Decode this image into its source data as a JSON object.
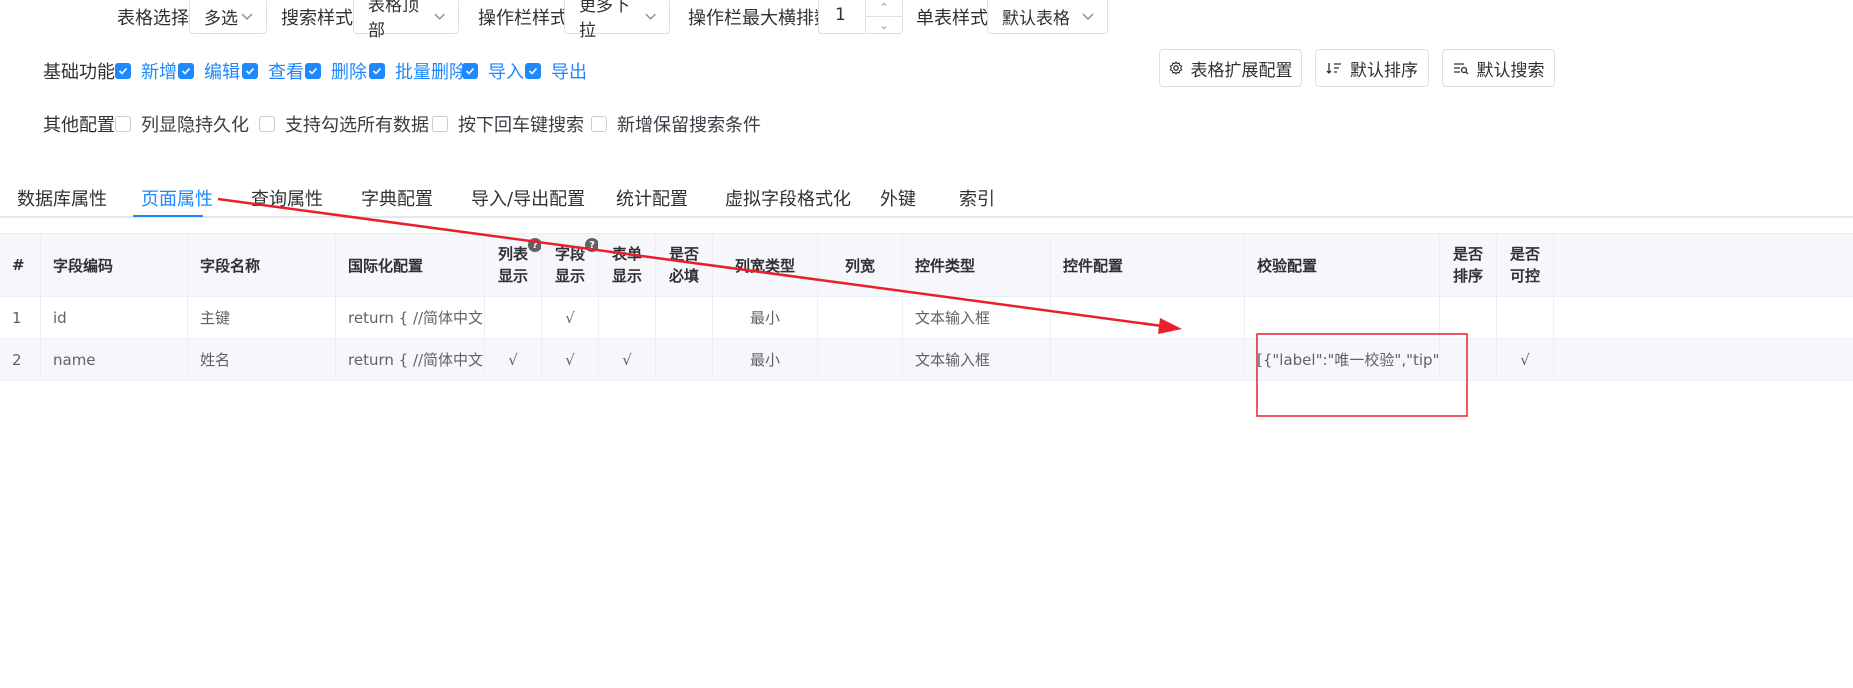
{
  "toolbar": {
    "table_select_label": "表格选择",
    "table_select_value": "多选",
    "search_style_label": "搜索样式",
    "search_style_value": "表格顶部",
    "action_style_label": "操作栏样式",
    "action_style_value": "更多下拉",
    "action_max_label": "操作栏最大横排数",
    "action_max_value": "1",
    "single_style_label": "单表样式",
    "single_style_value": "默认表格"
  },
  "basic": {
    "label": "基础功能",
    "items": [
      {
        "label": "新增",
        "checked": true
      },
      {
        "label": "编辑",
        "checked": true
      },
      {
        "label": "查看",
        "checked": true
      },
      {
        "label": "删除",
        "checked": true
      },
      {
        "label": "批量删除",
        "checked": true
      },
      {
        "label": "导入",
        "checked": true
      },
      {
        "label": "导出",
        "checked": true
      }
    ]
  },
  "buttons": {
    "ext": "表格扩展配置",
    "sort": "默认排序",
    "search": "默认搜索"
  },
  "other": {
    "label": "其他配置",
    "items": [
      {
        "label": "列显隐持久化",
        "checked": false
      },
      {
        "label": "支持勾选所有数据",
        "checked": false
      },
      {
        "label": "按下回车键搜索",
        "checked": false
      },
      {
        "label": "新增保留搜索条件",
        "checked": false
      }
    ]
  },
  "tabs": [
    {
      "label": "数据库属性",
      "active": false
    },
    {
      "label": "页面属性",
      "active": true
    },
    {
      "label": "查询属性",
      "active": false
    },
    {
      "label": "字典配置",
      "active": false
    },
    {
      "label": "导入/导出配置",
      "active": false
    },
    {
      "label": "统计配置",
      "active": false
    },
    {
      "label": "虚拟字段格式化",
      "active": false
    },
    {
      "label": "外键",
      "active": false
    },
    {
      "label": "索引",
      "active": false
    }
  ],
  "table": {
    "headers": {
      "index": "#",
      "field_code": "字段编码",
      "field_name": "字段名称",
      "i18n": "国际化配置",
      "list_show_1": "列表",
      "list_show_2": "显示",
      "field_show_1": "字段",
      "field_show_2": "显示",
      "form_show_1": "表单",
      "form_show_2": "显示",
      "required_1": "是否",
      "required_2": "必填",
      "col_width_type": "列宽类型",
      "col_width": "列宽",
      "control_type": "控件类型",
      "control_config": "控件配置",
      "validate_config": "校验配置",
      "sortable_1": "是否",
      "sortable_2": "排序",
      "controllable_1": "是否",
      "controllable_2": "可控"
    },
    "rows": [
      {
        "index": "1",
        "code": "id",
        "name": "主键",
        "i18n": "return { //简体中文...",
        "list_show": "",
        "field_show": "√",
        "form_show": "",
        "required": "",
        "width_type": "最小",
        "width": "",
        "control_type": "文本输入框",
        "control_config": "",
        "validate": "",
        "sortable": "",
        "controllable": ""
      },
      {
        "index": "2",
        "code": "name",
        "name": "姓名",
        "i18n": "return { //简体中文...",
        "list_show": "√",
        "field_show": "√",
        "form_show": "√",
        "required": "",
        "width_type": "最小",
        "width": "",
        "control_type": "文本输入框",
        "control_config": "",
        "validate": "[{\"label\":\"唯一校验\",\"tip\":\"...",
        "sortable": "",
        "controllable": "√"
      }
    ]
  },
  "colors": {
    "accent": "#1e88ff",
    "annotation": "#e8202a"
  }
}
